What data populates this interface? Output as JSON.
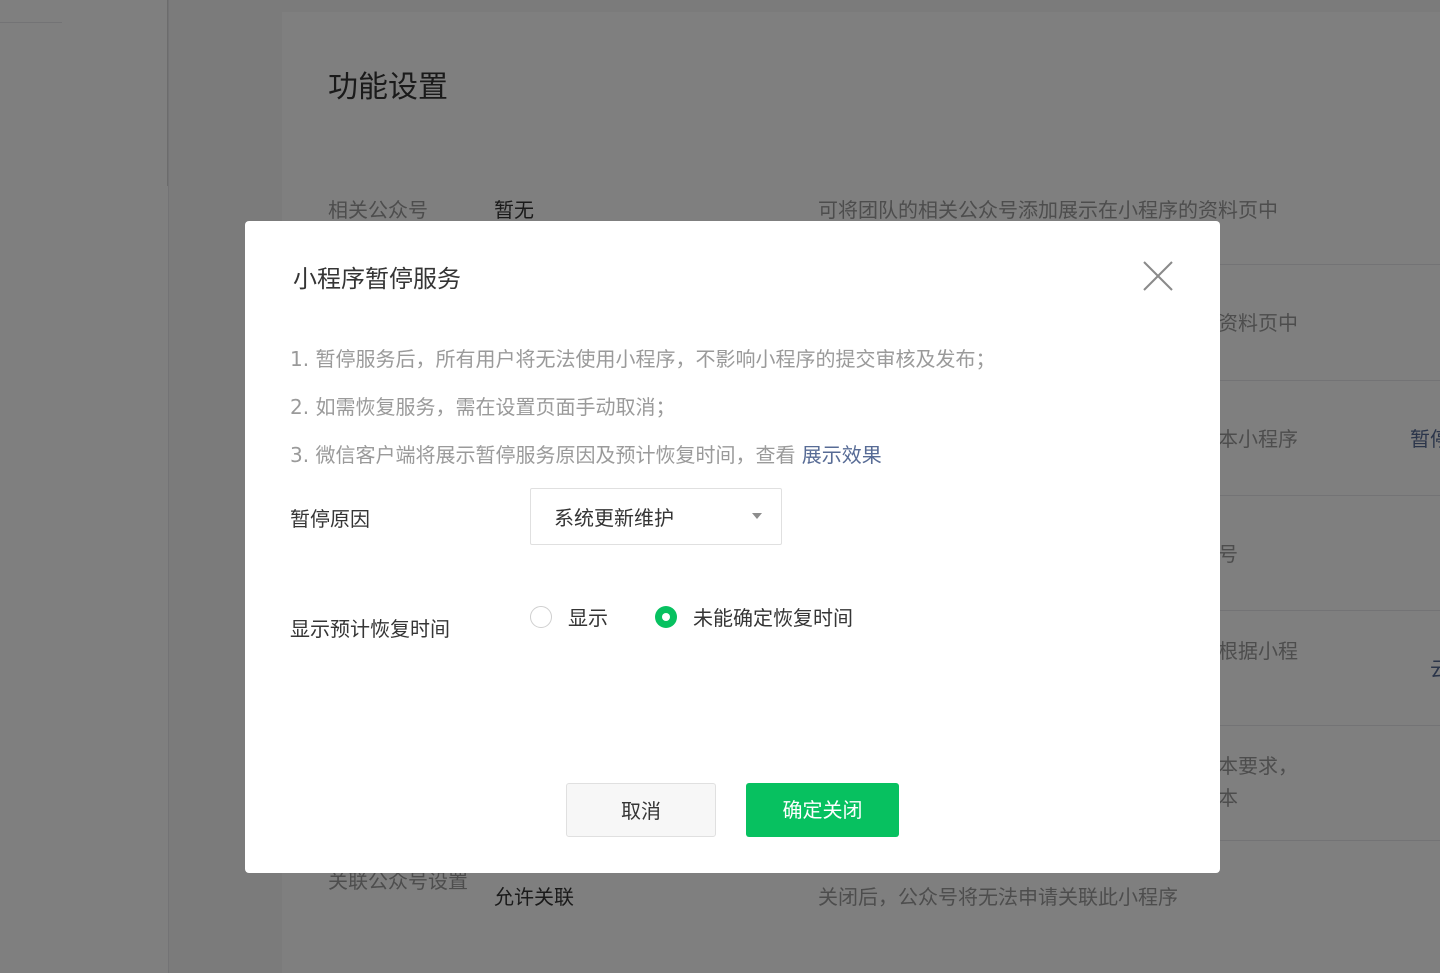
{
  "page": {
    "title": "功能设置",
    "rows": [
      {
        "label": "相关公众号",
        "value": "暂无",
        "desc": "可将团队的相关公众号添加展示在小程序的资料页中",
        "action": ""
      },
      {
        "label": "",
        "value": "",
        "desc": "资料页中",
        "action": ""
      },
      {
        "label": "",
        "value": "",
        "desc": "本小程序",
        "action": "暂停"
      },
      {
        "label": "",
        "value": "",
        "desc": "号",
        "action": ""
      },
      {
        "label": "",
        "value": "",
        "desc": "根据小程",
        "action": "云"
      },
      {
        "label": "",
        "value": "",
        "desc": "本要求，",
        "desc2": "本",
        "action": ""
      },
      {
        "label": "关联公众号设置",
        "value": "允许关联",
        "desc": "关闭后，公众号将无法申请关联此小程序",
        "action": ""
      }
    ]
  },
  "dialog": {
    "title": "小程序暂停服务",
    "notes": [
      "1. 暂停服务后，所有用户将无法使用小程序，不影响小程序的提交审核及发布；",
      "2. 如需恢复服务，需在设置页面手动取消；",
      "3. 微信客户端将展示暂停服务原因及预计恢复时间，查看 "
    ],
    "notes_link": "展示效果",
    "reason_label": "暂停原因",
    "reason_value": "系统更新维护",
    "restore_label": "显示预计恢复时间",
    "radio_show": "显示",
    "radio_unknown": "未能确定恢复时间",
    "selected_option": "未能确定恢复时间",
    "cancel_label": "取消",
    "confirm_label": "确定关闭"
  },
  "colors": {
    "accent": "#07c160",
    "link": "#576b95",
    "overlay": "rgba(0,0,0,0.5)"
  },
  "icons": {
    "close": "close-icon",
    "select_arrow": "caret-down-icon"
  }
}
